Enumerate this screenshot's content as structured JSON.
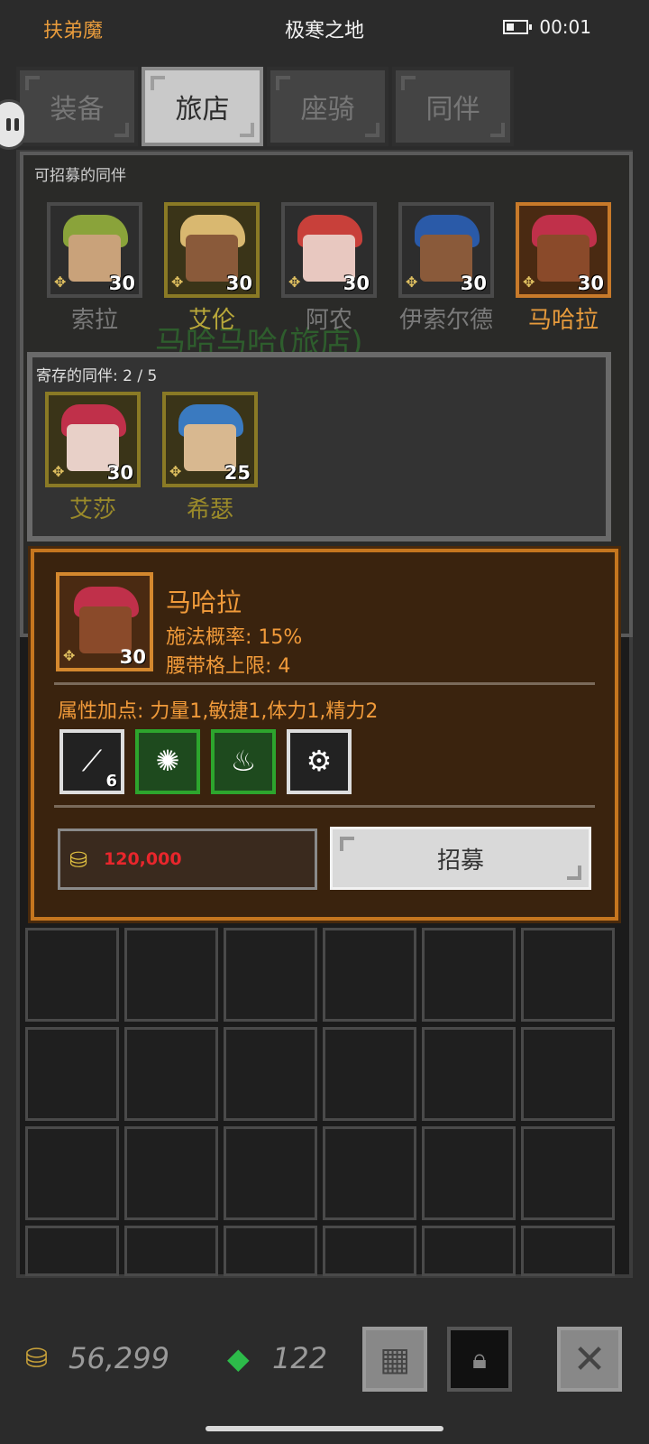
{
  "status_bar": {
    "left_label": "扶弟魔",
    "title": "极寒之地",
    "time": "00:01"
  },
  "tabs": [
    {
      "label": "装备",
      "active": false
    },
    {
      "label": "旅店",
      "active": true
    },
    {
      "label": "座骑",
      "active": false
    },
    {
      "label": "同伴",
      "active": false
    }
  ],
  "inn": {
    "recruitable_label": "可招募的同伴",
    "background_title": "马哈马哈(旅店)",
    "heroes": [
      {
        "name": "索拉",
        "level": "30",
        "name_color": "#7a7a7a",
        "frame": "plain",
        "hair": "#8aa33a",
        "skin": "#c9a27a"
      },
      {
        "name": "艾伦",
        "level": "30",
        "name_color": "#b9a83a",
        "frame": "gold",
        "hair": "#d9b870",
        "skin": "#8a5a3a"
      },
      {
        "name": "阿农",
        "level": "30",
        "name_color": "#7a7a7a",
        "frame": "plain",
        "hair": "#c8403a",
        "skin": "#e8c8c0"
      },
      {
        "name": "伊索尔德",
        "level": "30",
        "name_color": "#7a7a7a",
        "frame": "plain",
        "hair": "#2a5aa8",
        "skin": "#8a5a3a"
      },
      {
        "name": "马哈拉",
        "level": "30",
        "name_color": "#e79b3c",
        "frame": "orange",
        "hair": "#c0304a",
        "skin": "#8a4a2a"
      }
    ]
  },
  "storage": {
    "label": "寄存的同伴: 2 / 5",
    "heroes": [
      {
        "name": "艾莎",
        "level": "30",
        "name_color": "#9a8a2a",
        "frame": "gold",
        "hair": "#c0304a",
        "skin": "#e8d0c8"
      },
      {
        "name": "希瑟",
        "level": "25",
        "name_color": "#9a8a2a",
        "frame": "gold",
        "hair": "#3a7ac0",
        "skin": "#d8b890"
      }
    ]
  },
  "detail": {
    "name": "马哈拉",
    "level": "30",
    "cast_chance": "施法概率: 15%",
    "belt_limit": "腰带格上限: 4",
    "attributes": "属性加点: 力量1,敏捷1,体力1,精力2",
    "skills": [
      {
        "icon": "staff-icon",
        "glyph": "⟋",
        "style": "white",
        "count": "6"
      },
      {
        "icon": "splash-icon",
        "glyph": "✺",
        "style": "green",
        "count": ""
      },
      {
        "icon": "flame-icon",
        "glyph": "♨",
        "style": "green",
        "count": ""
      },
      {
        "icon": "cog-icon",
        "glyph": "⚙",
        "style": "white",
        "count": ""
      }
    ],
    "price": "120,000",
    "recruit_label": "招募"
  },
  "currency": {
    "gold": "56,299",
    "gems": "122"
  },
  "colors": {
    "accent_orange": "#e79b3c",
    "price_red": "#e8262c"
  }
}
